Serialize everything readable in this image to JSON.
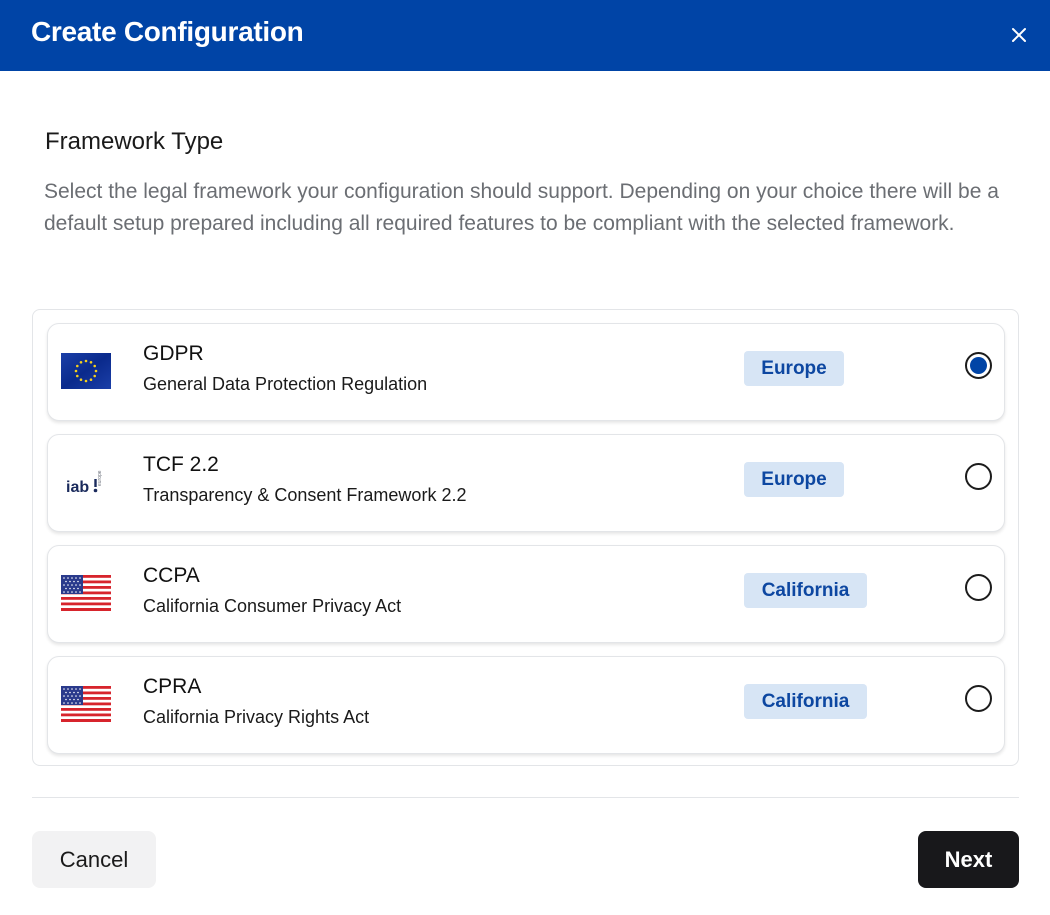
{
  "dialog": {
    "title": "Create Configuration",
    "close_icon": "close-icon"
  },
  "section": {
    "title": "Framework Type",
    "description": "Select the legal framework your configuration should support. Depending on your choice there will be a default setup prepared including all required features to be compliant with the selected framework."
  },
  "frameworks": [
    {
      "name": "GDPR",
      "full_name": "General Data Protection Regulation",
      "region": "Europe",
      "icon": "eu-flag-icon",
      "selected": true
    },
    {
      "name": "TCF 2.2",
      "full_name": "Transparency & Consent Framework 2.2",
      "region": "Europe",
      "icon": "iab-europe-logo",
      "logo_text": "iab.",
      "logo_subtext": "europe",
      "selected": false
    },
    {
      "name": "CCPA",
      "full_name": "California Consumer Privacy Act",
      "region": "California",
      "icon": "us-flag-icon",
      "selected": false
    },
    {
      "name": "CPRA",
      "full_name": "California Privacy Rights Act",
      "region": "California",
      "icon": "us-flag-icon",
      "selected": false
    }
  ],
  "footer": {
    "cancel_label": "Cancel",
    "next_label": "Next"
  },
  "colors": {
    "header_bg": "#0044a6",
    "badge_bg": "#d7e5f5",
    "badge_text": "#0d47a1",
    "next_bg": "#18181b"
  }
}
